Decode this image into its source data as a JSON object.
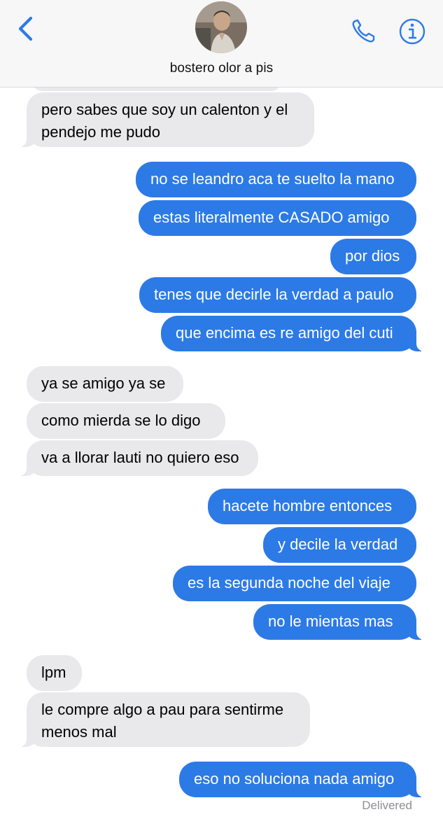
{
  "header": {
    "contact_name": "bostero olor a pis",
    "back_icon": "chevron-left-icon",
    "call_icon": "phone-icon",
    "info_icon": "info-icon",
    "accent_color": "#2c7ae6"
  },
  "messages": [
    {
      "direction": "incoming",
      "lines": [
        "pero sabes que soy un calenton y el",
        "pendejo me pudo"
      ]
    },
    {
      "direction": "outgoing",
      "lines": [
        "no se leandro aca te suelto la mano"
      ]
    },
    {
      "direction": "outgoing",
      "lines": [
        "estas literalmente CASADO amigo"
      ]
    },
    {
      "direction": "outgoing",
      "lines": [
        "por dios"
      ]
    },
    {
      "direction": "outgoing",
      "lines": [
        "tenes que decirle la verdad a paulo"
      ]
    },
    {
      "direction": "outgoing",
      "lines": [
        "que encima es re amigo del cuti"
      ]
    },
    {
      "direction": "incoming",
      "lines": [
        "ya se amigo ya se"
      ]
    },
    {
      "direction": "incoming",
      "lines": [
        "como mierda se lo digo"
      ]
    },
    {
      "direction": "incoming",
      "lines": [
        "va a llorar lauti no quiero eso"
      ]
    },
    {
      "direction": "outgoing",
      "lines": [
        "hacete hombre entonces"
      ]
    },
    {
      "direction": "outgoing",
      "lines": [
        "y decile la verdad"
      ]
    },
    {
      "direction": "outgoing",
      "lines": [
        "es la segunda noche del viaje"
      ]
    },
    {
      "direction": "outgoing",
      "lines": [
        "no le mientas mas"
      ]
    },
    {
      "direction": "incoming",
      "lines": [
        "lpm"
      ]
    },
    {
      "direction": "incoming",
      "lines": [
        "le compre algo a pau para sentirme",
        "menos mal"
      ]
    },
    {
      "direction": "outgoing",
      "lines": [
        "eso no soluciona nada amigo"
      ]
    }
  ],
  "status": {
    "delivered": "Delivered"
  },
  "colors": {
    "incoming_bubble": "#e9e9eb",
    "outgoing_bubble": "#2c7ae6"
  }
}
